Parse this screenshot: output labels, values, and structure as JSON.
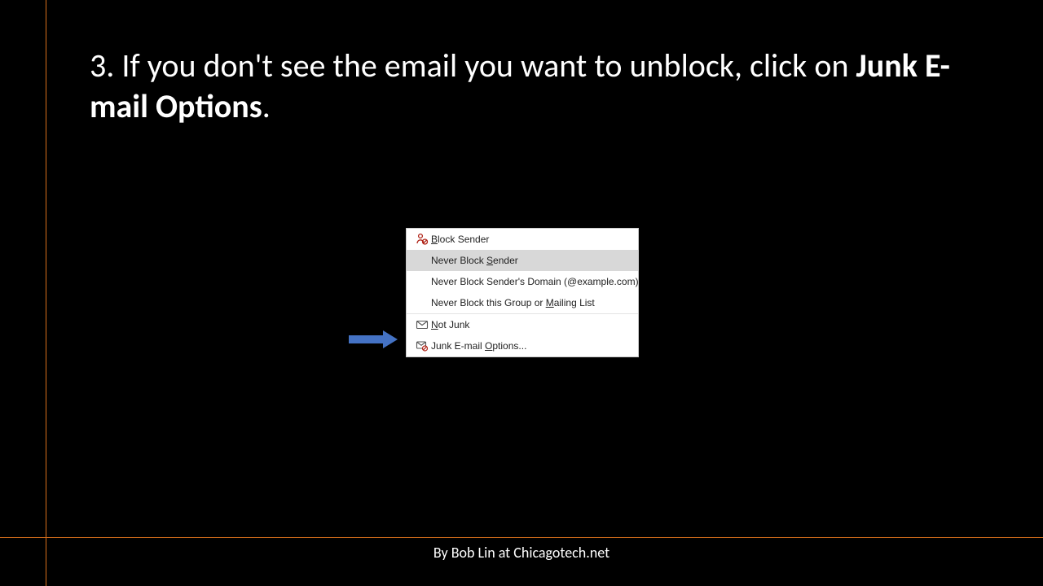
{
  "slide": {
    "heading_prefix": "3. If you don't see the email you want to unblock, click on ",
    "heading_bold": "Junk E-mail Options",
    "heading_suffix": "."
  },
  "menu": {
    "block_sender": "Block Sender",
    "never_block_sender": "Never Block Sender",
    "never_block_domain": "Never Block Sender's Domain (@example.com)",
    "never_block_group_pre": "Never Block this Group or ",
    "never_block_group_u": "M",
    "never_block_group_post": "ailing List",
    "not_junk_u": "N",
    "not_junk_post": "ot Junk",
    "junk_options_pre": "Junk E-mail ",
    "junk_options_u": "O",
    "junk_options_post": "ptions..."
  },
  "footer": {
    "credit": "By Bob Lin at Chicagotech.net"
  }
}
